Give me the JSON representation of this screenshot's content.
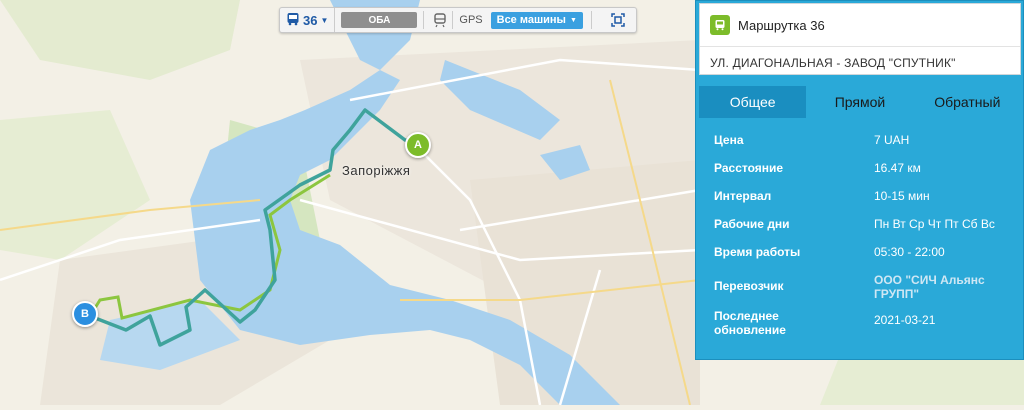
{
  "toolbar": {
    "route_number": "36",
    "region": "ОБА",
    "gps_label": "GPS",
    "vehicles_select": "Все машины"
  },
  "map": {
    "city_label": "Запоріжжя",
    "marker_a": "A",
    "marker_b": "B",
    "colors": {
      "route_main": "#3fa39c",
      "route_alt": "#8cc63f"
    }
  },
  "panel": {
    "title": "Маршрутка 36",
    "subtitle": "УЛ. ДИАГОНАЛЬНАЯ - ЗАВОД \"СПУТНИК\"",
    "tabs": [
      "Общее",
      "Прямой",
      "Обратный"
    ],
    "active_tab": "Общее",
    "info": [
      {
        "label": "Цена",
        "value": "7 UAH"
      },
      {
        "label": "Расстояние",
        "value": "16.47 км"
      },
      {
        "label": "Интервал",
        "value": "10-15 мин"
      },
      {
        "label": "Рабочие дни",
        "value": "Пн Вт Ср Чт Пт Сб Вс"
      },
      {
        "label": "Время работы",
        "value": "05:30 - 22:00"
      },
      {
        "label": "Перевозчик",
        "value": "ООО \"СИЧ Альянс ГРУПП\""
      },
      {
        "label": "Последнее обновление",
        "value": "2021-03-21"
      }
    ],
    "colors": {
      "panel_bg": "#2aa9d8",
      "active_tab": "#1a8ec0",
      "badge": "#7cbc2a"
    }
  }
}
